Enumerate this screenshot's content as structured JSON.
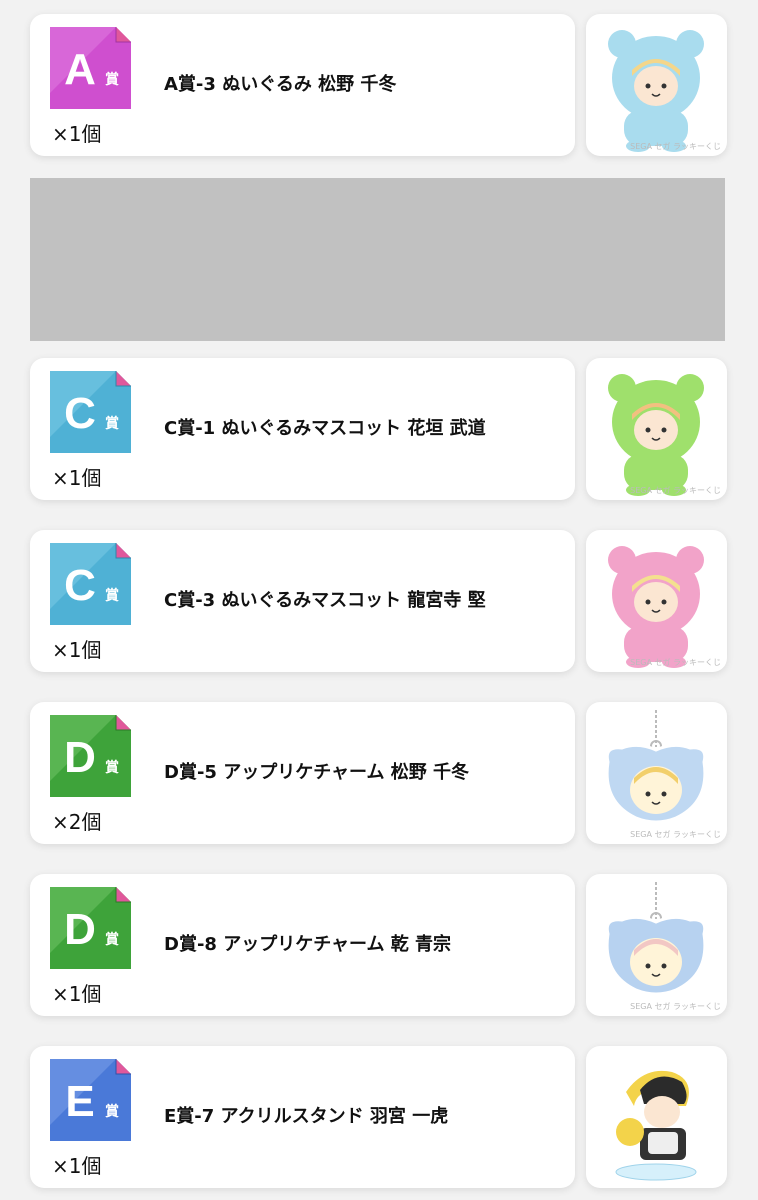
{
  "items": [
    {
      "grade": "A",
      "grade_suffix": "賞",
      "title": "A賞-3 ぬいぐるみ 松野 千冬",
      "qty": "×1個",
      "badge_color": "#cf4fcf",
      "badge_light": "#e07be0",
      "badge_fold": "#a234a2",
      "thumb_icon": "plush-bear-hood-icon",
      "thumb_color": "#a9dcee",
      "thumb_hair": "#f4d68a",
      "watermark": "SEGA セガ ラッキーくじ"
    },
    {
      "grade": "C",
      "grade_suffix": "賞",
      "title": "C賞-1 ぬいぐるみマスコット 花垣 武道",
      "qty": "×1個",
      "badge_color": "#4fb1d5",
      "badge_light": "#7ccbe6",
      "badge_fold": "#2e86aa",
      "thumb_icon": "plush-mascot-icon",
      "thumb_color": "#9fe06c",
      "thumb_hair": "#f2c080",
      "watermark": "SEGA セガ ラッキーくじ"
    },
    {
      "grade": "C",
      "grade_suffix": "賞",
      "title": "C賞-3 ぬいぐるみマスコット 龍宮寺 堅",
      "qty": "×1個",
      "badge_color": "#4fb1d5",
      "badge_light": "#7ccbe6",
      "badge_fold": "#2e86aa",
      "thumb_icon": "plush-mascot-icon",
      "thumb_color": "#f2a3c9",
      "thumb_hair": "#f4e08f",
      "watermark": "SEGA セガ ラッキーくじ"
    },
    {
      "grade": "D",
      "grade_suffix": "賞",
      "title": "D賞-5 アップリケチャーム 松野 千冬",
      "qty": "×2個",
      "badge_color": "#3ea33a",
      "badge_light": "#6fc466",
      "badge_fold": "#2a7b27",
      "thumb_icon": "applique-charm-icon",
      "thumb_color": "#bfd8f2",
      "thumb_hair": "#f2cf6b",
      "watermark": "SEGA セガ ラッキーくじ"
    },
    {
      "grade": "D",
      "grade_suffix": "賞",
      "title": "D賞-8 アップリケチャーム 乾 青宗",
      "qty": "×1個",
      "badge_color": "#3ea33a",
      "badge_light": "#6fc466",
      "badge_fold": "#2a7b27",
      "thumb_icon": "applique-charm-icon",
      "thumb_color": "#b7d2f0",
      "thumb_hair": "#f2c7c4",
      "watermark": "SEGA セガ ラッキーくじ"
    },
    {
      "grade": "E",
      "grade_suffix": "賞",
      "title": "E賞-7 アクリルスタンド 羽宮 一虎",
      "qty": "×1個",
      "badge_color": "#4a79d8",
      "badge_light": "#7ca0ea",
      "badge_fold": "#2d52a8",
      "thumb_icon": "acrylic-stand-icon",
      "thumb_color": "#f3d34a",
      "thumb_hair": "#2b2b2b",
      "watermark": ""
    }
  ],
  "ad_placeholder": {
    "color": "#c1c1c1"
  }
}
